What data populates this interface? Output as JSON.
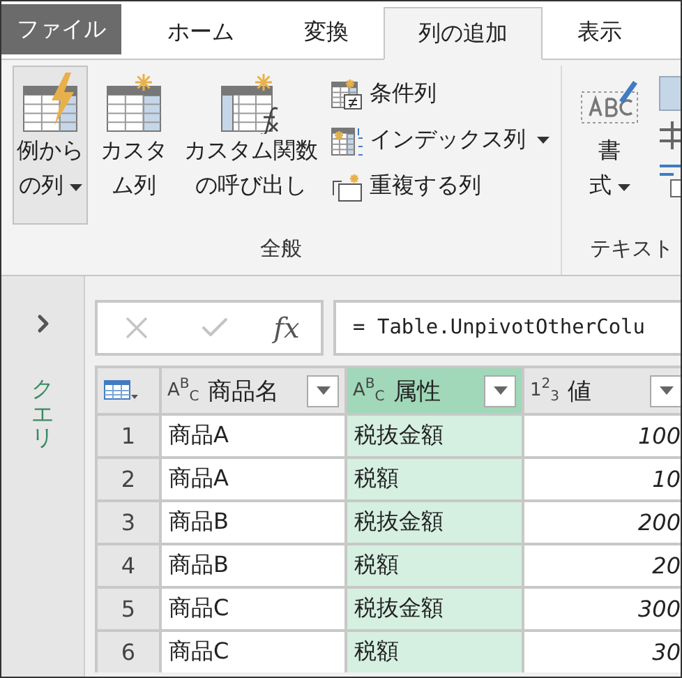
{
  "tabs": [
    {
      "label": "ファイル",
      "kind": "file",
      "selected": false
    },
    {
      "label": "ホーム",
      "kind": "tab",
      "selected": false
    },
    {
      "label": "変換",
      "kind": "tab",
      "selected": false
    },
    {
      "label": "列の追加",
      "kind": "tab",
      "selected": true
    },
    {
      "label": "表示",
      "kind": "tab",
      "selected": false
    }
  ],
  "ribbon": {
    "groups": [
      {
        "label": "全般",
        "large_buttons": [
          {
            "lines": [
              "例から",
              "の列"
            ],
            "dropdown": true,
            "selected": true
          },
          {
            "lines": [
              "カスタ",
              "ム列"
            ],
            "dropdown": false,
            "selected": false
          },
          {
            "lines": [
              "カスタム関数",
              "の呼び出し"
            ],
            "dropdown": false,
            "selected": false
          }
        ],
        "small_buttons": [
          {
            "label": "条件列",
            "dropdown": false
          },
          {
            "label": "インデックス列",
            "dropdown": true
          },
          {
            "label": "重複する列",
            "dropdown": false
          }
        ]
      },
      {
        "label": "テキスト",
        "large_buttons": [
          {
            "lines": [
              "書",
              "式"
            ],
            "dropdown": true,
            "selected": false
          }
        ]
      }
    ]
  },
  "sidebar": {
    "title": "クエリ"
  },
  "formula_bar": {
    "fx": "fx",
    "formula": "= Table.UnpivotOtherColu"
  },
  "table": {
    "columns": [
      {
        "type_glyph": "A$^{B}$$_{C}$",
        "name": "商品名",
        "kind": "text",
        "selected": false
      },
      {
        "type_glyph": "A$^{B}$$_{C}$",
        "name": "属性",
        "kind": "text",
        "selected": true
      },
      {
        "type_glyph": "1$^{2}$$_{3}$",
        "name": "値",
        "kind": "number",
        "selected": false
      }
    ],
    "rows": [
      {
        "index": "1",
        "cells": [
          "商品A",
          "税抜金額",
          "100"
        ]
      },
      {
        "index": "2",
        "cells": [
          "商品A",
          "税額",
          "10"
        ]
      },
      {
        "index": "3",
        "cells": [
          "商品B",
          "税抜金額",
          "200"
        ]
      },
      {
        "index": "4",
        "cells": [
          "商品B",
          "税額",
          "20"
        ]
      },
      {
        "index": "5",
        "cells": [
          "商品C",
          "税抜金額",
          "300"
        ]
      },
      {
        "index": "6",
        "cells": [
          "商品C",
          "税額",
          "30"
        ]
      }
    ]
  }
}
